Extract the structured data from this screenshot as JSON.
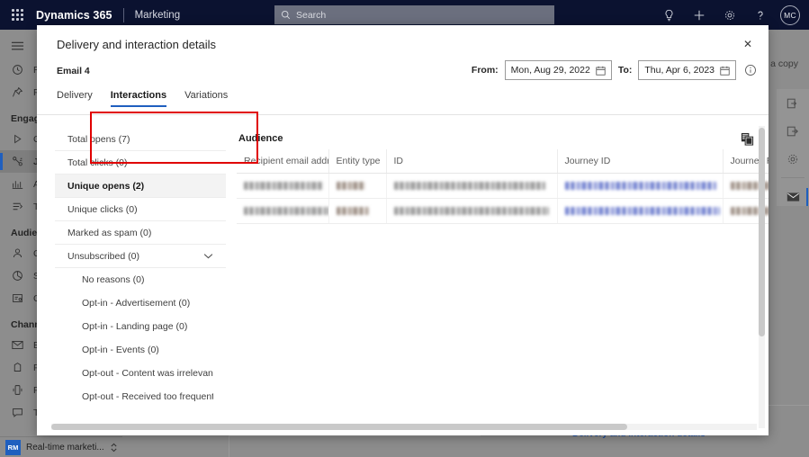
{
  "appbar": {
    "waffle_label": "app-launcher",
    "brand": "Dynamics 365",
    "app_name": "Marketing",
    "search_placeholder": "Search",
    "icons": [
      "lightbulb-icon",
      "plus-icon",
      "gear-icon",
      "help-icon"
    ],
    "avatar_initials": "MC"
  },
  "sidebar": {
    "hamburger": "menu-icon",
    "quick": [
      {
        "label": "Recent",
        "icon": "clock-icon"
      },
      {
        "label": "Pinned",
        "icon": "pin-icon"
      }
    ],
    "groups": [
      {
        "title": "Engagement",
        "items": [
          {
            "label": "Get started",
            "icon": "play-icon",
            "selected": false
          },
          {
            "label": "Journeys",
            "icon": "journey-icon",
            "selected": true
          },
          {
            "label": "Analytics",
            "icon": "analytics-icon",
            "selected": false
          },
          {
            "label": "Triggers",
            "icon": "trigger-icon",
            "selected": false
          }
        ]
      },
      {
        "title": "Audience",
        "items": [
          {
            "label": "Contacts",
            "icon": "person-icon",
            "selected": false
          },
          {
            "label": "Segments",
            "icon": "segment-icon",
            "selected": false
          },
          {
            "label": "Consent",
            "icon": "consent-icon",
            "selected": false
          }
        ]
      },
      {
        "title": "Channels",
        "items": [
          {
            "label": "Email",
            "icon": "envelope-icon",
            "selected": false
          },
          {
            "label": "Forms",
            "icon": "form-icon",
            "selected": false
          },
          {
            "label": "Push",
            "icon": "push-icon",
            "selected": false
          },
          {
            "label": "Text",
            "icon": "text-icon",
            "selected": false
          }
        ]
      }
    ],
    "app_switcher": {
      "badge": "RM",
      "label": "Real-time marketi..."
    }
  },
  "background": {
    "save_copy": "a copy",
    "link_text": "Delivery and interaction details",
    "rail_icons": [
      "sign-in-icon",
      "sign-out-icon",
      "gear-icon",
      "envelope-icon"
    ]
  },
  "dialog": {
    "title": "Delivery and interaction details",
    "close_label": "✕",
    "subject": "Email 4",
    "date_range": {
      "from_label": "From:",
      "from_value": "Mon, Aug 29, 2022",
      "to_label": "To:",
      "to_value": "Thu, Apr 6, 2023",
      "info_icon": "info-icon"
    },
    "tabs": [
      {
        "label": "Delivery",
        "active": false
      },
      {
        "label": "Interactions",
        "active": true
      },
      {
        "label": "Variations",
        "active": false
      }
    ],
    "metrics": [
      {
        "label": "Total opens (7)",
        "selected": false,
        "sub": false,
        "expandable": false
      },
      {
        "label": "Total clicks (0)",
        "selected": false,
        "sub": false,
        "expandable": false
      },
      {
        "label": "Unique opens (2)",
        "selected": true,
        "sub": false,
        "expandable": false
      },
      {
        "label": "Unique clicks (0)",
        "selected": false,
        "sub": false,
        "expandable": false
      },
      {
        "label": "Marked as spam (0)",
        "selected": false,
        "sub": false,
        "expandable": false
      },
      {
        "label": "Unsubscribed (0)",
        "selected": false,
        "sub": false,
        "expandable": true
      },
      {
        "label": "No reasons (0)",
        "selected": false,
        "sub": true,
        "expandable": false
      },
      {
        "label": "Opt-in - Advertisement (0)",
        "selected": false,
        "sub": true,
        "expandable": false
      },
      {
        "label": "Opt-in - Landing page (0)",
        "selected": false,
        "sub": true,
        "expandable": false
      },
      {
        "label": "Opt-in - Events (0)",
        "selected": false,
        "sub": true,
        "expandable": false
      },
      {
        "label": "Opt-out - Content was irrelevant (",
        "selected": false,
        "sub": true,
        "expandable": false
      },
      {
        "label": "Opt-out - Received too frequently",
        "selected": false,
        "sub": true,
        "expandable": false
      }
    ],
    "highlight_color": "#e00000",
    "accent_color": "#1f5fbf",
    "audience": {
      "title": "Audience",
      "copy_icon": "copy-table-icon",
      "columns": [
        "Recipient email address",
        "Entity type",
        "ID",
        "Journey ID",
        "Journey Run"
      ],
      "rows": [
        {
          "cells": [
            "redacted",
            "redacted",
            "redacted",
            "redacted",
            "redacted"
          ]
        },
        {
          "cells": [
            "redacted",
            "redacted",
            "redacted",
            "redacted",
            "redacted"
          ]
        }
      ]
    }
  }
}
